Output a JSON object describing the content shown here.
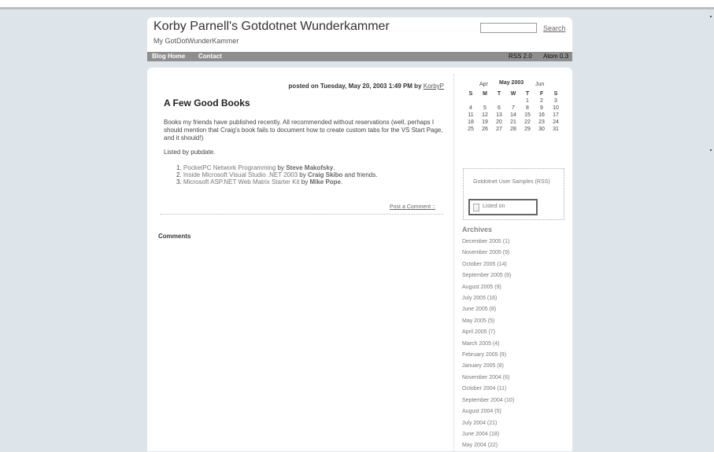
{
  "header": {
    "title": "Korby Parnell's Gotdotnet Wunderkammer",
    "subtitle": "My GotDotWunderKammer",
    "search_label": "Search"
  },
  "nav": {
    "items": [
      "Blog Home",
      "Contact"
    ],
    "feeds": [
      "RSS 2.0",
      "Atom 0.3"
    ]
  },
  "post": {
    "meta_prefix": "posted on Tuesday, May 20, 2003 1:49 PM by",
    "author": "KorbyP",
    "title": "A Few Good Books",
    "body": "Books my friends have published recently. All recommended without reservations (well, perhaps I should mention that Craig's book fails to document how to create custom tabs for the VS Start Page, and it should!)",
    "listed_by": "Listed by pubdate.",
    "books": [
      {
        "num": "1.",
        "title": "PocketPC Network Programming",
        "by": "by",
        "author": "Steve Makofsky",
        "suffix": "."
      },
      {
        "num": "2.",
        "title": "Inside Microsoft Visual Studio .NET 2003",
        "by": "by",
        "author": "Craig Skibo",
        "suffix": "and friends."
      },
      {
        "num": "3.",
        "title": "Microsoft ASP.NET Web Matrix Starter Kit",
        "by": "by",
        "author": "Mike Pope",
        "suffix": "."
      }
    ],
    "comment_link": "Post a Comment",
    "comment_sep": "::"
  },
  "comments": {
    "heading": "Comments"
  },
  "calendar": {
    "prev": "Apr",
    "current": "May 2003",
    "next": "Jun",
    "weekdays": [
      "S",
      "M",
      "T",
      "W",
      "T",
      "F",
      "S"
    ],
    "weeks": [
      [
        "",
        "",
        "",
        "",
        "1",
        "2",
        "3"
      ],
      [
        "4",
        "5",
        "6",
        "7",
        "8",
        "9",
        "10"
      ],
      [
        "11",
        "12",
        "13",
        "14",
        "15",
        "16",
        "17"
      ],
      [
        "18",
        "19",
        "20",
        "21",
        "22",
        "23",
        "24"
      ],
      [
        "25",
        "26",
        "27",
        "28",
        "29",
        "30",
        "31"
      ]
    ]
  },
  "feedbox": {
    "text": "Gotdotnet User Samples (RSS)",
    "button": "Listed on"
  },
  "archives": {
    "title": "Archives",
    "items": [
      "December 2005 (1)",
      "November 2005 (9)",
      "October 2005 (14)",
      "September 2005 (9)",
      "August 2005 (9)",
      "July 2005 (16)",
      "June 2005 (8)",
      "May 2005 (5)",
      "April 2005 (7)",
      "March 2005 (4)",
      "February 2005 (9)",
      "January 2005 (8)",
      "November 2004 (6)",
      "October 2004 (11)",
      "September 2004 (10)",
      "August 2004 (5)",
      "July 2004 (21)",
      "June 2004 (18)",
      "May 2004 (22)"
    ]
  }
}
